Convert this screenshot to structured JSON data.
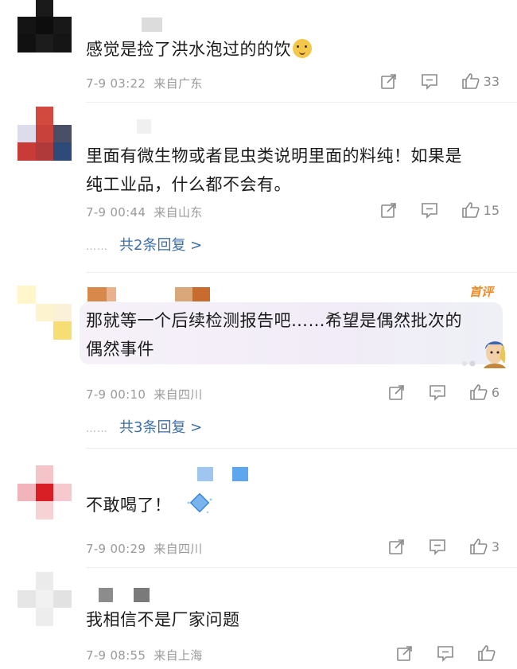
{
  "comments": [
    {
      "text": "感觉是捡了洪水泡过的的饮",
      "emoji": "doge-emoji",
      "date": "7-9 03:22",
      "location": "来自广东",
      "likes": "33"
    },
    {
      "text_line1": "里面有微生物或者昆虫类说明里面的料纯！如果是",
      "text_line2": "纯工业品，什么都不会有。",
      "date": "7-9 00:44",
      "location": "来自山东",
      "likes": "15",
      "replies": "共2条回复 >"
    },
    {
      "badge": "首评",
      "text_line1": "那就等一个后续检测报告吧……希望是偶然批次的",
      "text_line2": "偶然事件",
      "date": "7-9 00:10",
      "location": "来自四川",
      "likes": "6",
      "replies": "共3条回复 >"
    },
    {
      "text": "不敢喝了！",
      "date": "7-9 00:29",
      "location": "来自四川",
      "likes": "3"
    },
    {
      "text": "我相信不是厂家问题",
      "date": "7-9 08:55",
      "location": "来自上海",
      "likes": ""
    }
  ],
  "ui": {
    "reply_dots": "……",
    "link_color": "#3e6ea8",
    "meta_color": "#9a9a9a",
    "badge_color": "#f08a24",
    "icons": [
      "share-icon",
      "comment-icon",
      "thumbs-up-icon"
    ]
  }
}
